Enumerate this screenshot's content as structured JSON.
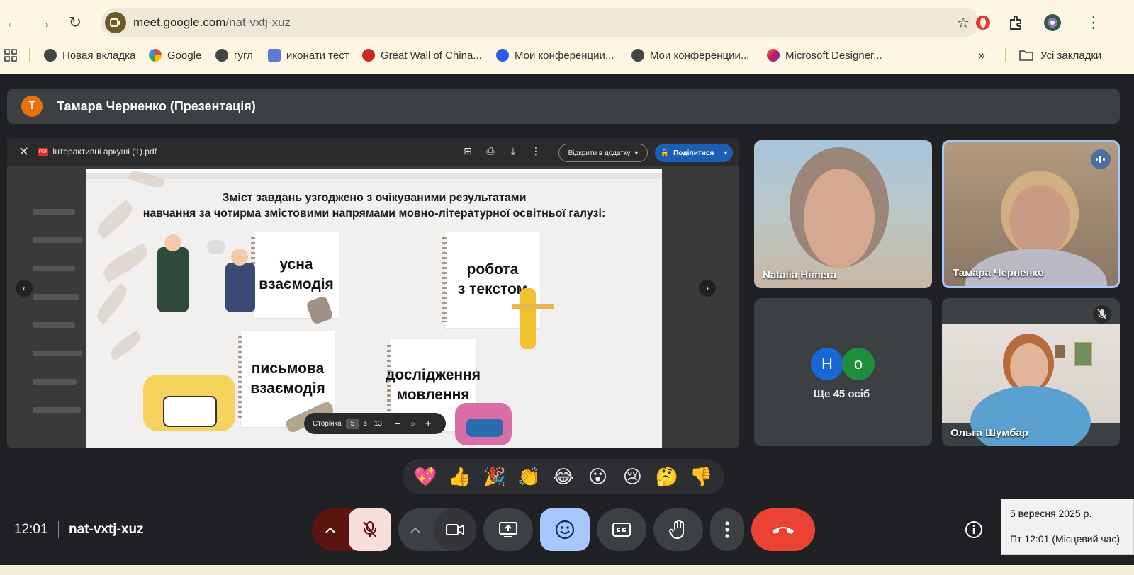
{
  "browser": {
    "url_host": "meet.google.com",
    "url_path": "/nat-vxtj-xuz",
    "bookmarks": [
      {
        "label": "Новая вкладка",
        "icon": "globe-icon",
        "color": "#444444"
      },
      {
        "label": "Google",
        "icon": "google-icon",
        "color": "#4285f4"
      },
      {
        "label": "гугл",
        "icon": "globe-icon",
        "color": "#444444"
      },
      {
        "label": "иконати тест",
        "icon": "grid-icon",
        "color": "#5b7bd5"
      },
      {
        "label": "Great Wall of China...",
        "icon": "dragon-icon",
        "color": "#c62828"
      },
      {
        "label": "Мои конференции...",
        "icon": "zoom-icon",
        "color": "#2d5be3"
      },
      {
        "label": "Мои конференции...",
        "icon": "globe-icon",
        "color": "#444444"
      },
      {
        "label": "Microsoft Designer...",
        "icon": "designer-icon",
        "color": "#c2185b"
      }
    ],
    "all_bookmarks_label": "Усі закладки"
  },
  "meet": {
    "presenter_initial": "T",
    "presenter_title": "Тамара Черненко (Презентація)",
    "meeting_code": "nat-vxtj-xuz",
    "clock": "12:01",
    "more_people_label": "Ще 45 осіб",
    "more_avatars": [
      {
        "letter": "Н",
        "color": "#1967d2"
      },
      {
        "letter": "о",
        "color": "#1e8e3e"
      }
    ],
    "participants": [
      {
        "name": "Natalia Himera"
      },
      {
        "name": "Тамара Черненко"
      },
      {
        "name": "Ольга Шумбар"
      }
    ],
    "reactions": [
      "💖",
      "👍",
      "🎉",
      "👏",
      "😂",
      "😮",
      "😢",
      "🤔",
      "👎"
    ]
  },
  "pdf": {
    "title": "Інтерактивні аркуші (1).pdf",
    "open_with_label": "Відкрити в додатку",
    "share_label": "Поділитися",
    "page_label": "Сторінка",
    "page_current": "5",
    "page_of": "з",
    "page_total": "13"
  },
  "slide": {
    "heading_line1": "Зміст завдань узгоджено з очікуваними результатами",
    "heading_line2": "навчання за чотирма змістовими напрямами мовно-літературної освітньої галузі:",
    "cards": [
      {
        "line1": "усна",
        "line2": "взаємодія"
      },
      {
        "line1": "робота",
        "line2": "з текстом"
      },
      {
        "line1": "письмова",
        "line2": "взаємодія"
      },
      {
        "line1": "дослідження",
        "line2": "мовлення"
      }
    ]
  },
  "tooltip": {
    "date": "5 вересня 2025 р.",
    "time": "Пт 12:01 (Місцевий час)"
  },
  "colors": {
    "end_call": "#ea4335",
    "mic_off_bg": "#f9dedc",
    "mic_group_bg": "#5c1410",
    "reactions_active": "#a8c7fa",
    "control_bg": "#3c4043"
  }
}
